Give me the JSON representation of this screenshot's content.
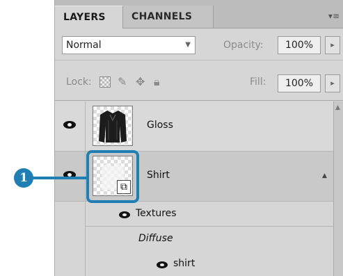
{
  "tabs": [
    {
      "label": "LAYERS",
      "active": true
    },
    {
      "label": "CHANNELS",
      "active": false
    }
  ],
  "panel_menu_icon": "panel-menu-icon",
  "blend": {
    "mode": "Normal",
    "opacity_label": "Opacity:",
    "opacity_value": "100%"
  },
  "lock": {
    "label": "Lock:",
    "fill_label": "Fill:",
    "fill_value": "100%"
  },
  "layers": [
    {
      "name": "Gloss",
      "visible": true
    },
    {
      "name": "Shirt",
      "visible": true,
      "smart_object": true
    }
  ],
  "effects": {
    "label": "Textures",
    "group": "Diffuse",
    "item": "shirt"
  },
  "callout": {
    "number": "1",
    "color": "#1f7fb5"
  }
}
